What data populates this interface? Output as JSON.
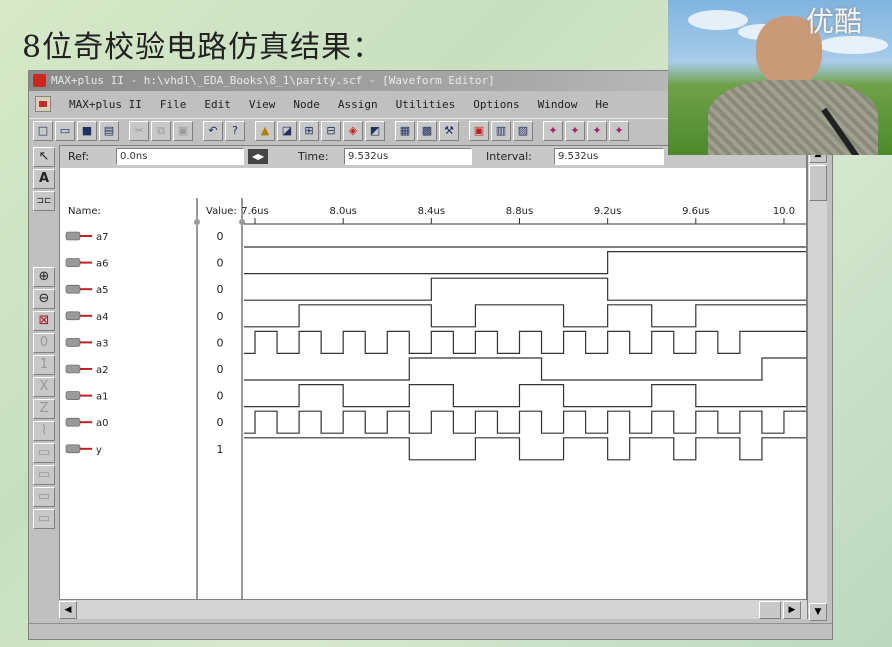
{
  "slide": {
    "title": "8位奇校验电路仿真结果："
  },
  "window": {
    "title": "MAX+plus II - h:\\vhdl\\_EDA_Books\\8_1\\parity.scf - [Waveform Editor]",
    "menu": [
      {
        "label": "MAX+plus II",
        "u": ""
      },
      {
        "label": "File",
        "u": ""
      },
      {
        "label": "Edit",
        "u": ""
      },
      {
        "label": "View",
        "u": ""
      },
      {
        "label": "Node",
        "u": ""
      },
      {
        "label": "Assign",
        "u": ""
      },
      {
        "label": "Utilities",
        "u": ""
      },
      {
        "label": "Options",
        "u": ""
      },
      {
        "label": "Window",
        "u": ""
      },
      {
        "label": "He",
        "u": ""
      }
    ]
  },
  "ref_bar": {
    "ref_label": "Ref:",
    "ref_value": "0.0ns",
    "time_label": "Time:",
    "time_value": "9.532us",
    "interval_label": "Interval:",
    "interval_value": "9.532us"
  },
  "columns": {
    "name": "Name:",
    "value": "Value:"
  },
  "time_axis": [
    "7.6us",
    "8.0us",
    "8.4us",
    "8.8us",
    "9.2us",
    "9.6us",
    "10.0"
  ],
  "signals": [
    {
      "name": "a7",
      "value": "0",
      "type": "input"
    },
    {
      "name": "a6",
      "value": "0",
      "type": "input"
    },
    {
      "name": "a5",
      "value": "0",
      "type": "input"
    },
    {
      "name": "a4",
      "value": "0",
      "type": "input"
    },
    {
      "name": "a3",
      "value": "0",
      "type": "input"
    },
    {
      "name": "a2",
      "value": "0",
      "type": "input"
    },
    {
      "name": "a1",
      "value": "0",
      "type": "input"
    },
    {
      "name": "a0",
      "value": "0",
      "type": "input"
    },
    {
      "name": "y",
      "value": "1",
      "type": "output"
    }
  ],
  "waveforms_us_edges": {
    "start": 7.55,
    "end": 10.1,
    "a7": {
      "init": 0,
      "edges": []
    },
    "a6": {
      "init": 0,
      "edges": [
        9.2
      ]
    },
    "a5": {
      "init": 0,
      "edges": [
        8.4,
        9.2
      ]
    },
    "a4": {
      "init": 0,
      "edges": [
        7.8,
        8.4,
        8.6,
        9.0,
        9.2,
        9.4,
        9.6
      ]
    },
    "a3": {
      "init": 0,
      "edges": [
        7.6,
        7.7,
        7.8,
        7.9,
        8.0,
        8.1,
        8.2,
        8.3,
        8.4,
        8.5,
        8.6,
        8.7,
        8.8,
        8.9,
        9.0,
        9.1,
        9.2,
        9.3,
        9.4,
        9.5,
        9.6,
        9.7,
        9.8
      ]
    },
    "a2": {
      "init": 0,
      "edges": [
        8.3,
        8.9,
        9.9
      ]
    },
    "a1": {
      "init": 0,
      "edges": [
        7.8,
        8.0,
        8.3,
        8.5,
        8.8,
        9.0,
        9.4,
        9.6
      ]
    },
    "a0": {
      "init": 0,
      "edges": [
        7.6,
        7.7,
        7.8,
        7.9,
        8.0,
        8.1,
        8.2,
        8.3,
        8.4,
        8.5,
        8.6,
        8.7,
        8.8,
        8.9,
        9.0,
        9.1,
        9.2,
        9.3,
        9.4,
        9.5,
        9.6,
        9.7,
        9.8,
        9.9,
        10.0
      ]
    },
    "y": {
      "init": 1,
      "edges": [
        8.3,
        8.6,
        8.8,
        9.0,
        9.2,
        9.3,
        9.5,
        9.6,
        9.8,
        9.9
      ]
    }
  },
  "watermark": "优酷",
  "icons": {
    "toolbar": [
      "new-icon",
      "open-icon",
      "save-icon",
      "print-icon",
      "cut-icon",
      "copy-icon",
      "paste-icon",
      "undo-icon",
      "help-icon",
      "hierarchy-up-icon",
      "floorplan-icon",
      "compiler-icon",
      "simulator-icon",
      "timing-icon",
      "programmer-icon",
      "open-scf-icon",
      "save-check-icon",
      "save-compile-icon",
      "save-simulate-icon",
      "zoom-fit-icon"
    ],
    "toolstrip": [
      "pointer-icon",
      "text-tool-icon",
      "node-tool-icon",
      "zoom-in-icon",
      "zoom-out-icon",
      "fit-window-icon",
      "force-low-icon",
      "force-high-icon",
      "invert-icon",
      "count-icon",
      "overwrite-clock-icon",
      "group-icon",
      "undefined-icon",
      "hi-z-icon",
      "stretch-icon"
    ]
  }
}
